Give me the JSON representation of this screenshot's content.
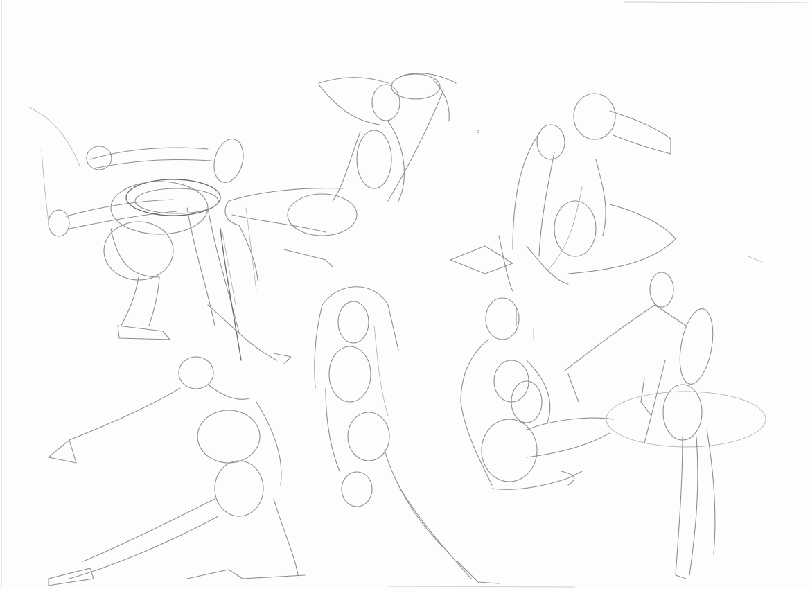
{
  "image": {
    "kind": "pencil gesture drawing sketch sheet",
    "paper_color": "#fdfdfc",
    "pencil_color": "#8d8d8d",
    "figures": [
      {
        "name": "leaping-figure"
      },
      {
        "name": "reclining-figure-arms-overhead"
      },
      {
        "name": "crouching-figure-head-down"
      },
      {
        "name": "standing-figure-arm-extended"
      },
      {
        "name": "lunging-figure-arm-extended"
      },
      {
        "name": "figure-arm-over-head"
      },
      {
        "name": "seated-figure-knees-up"
      }
    ]
  }
}
